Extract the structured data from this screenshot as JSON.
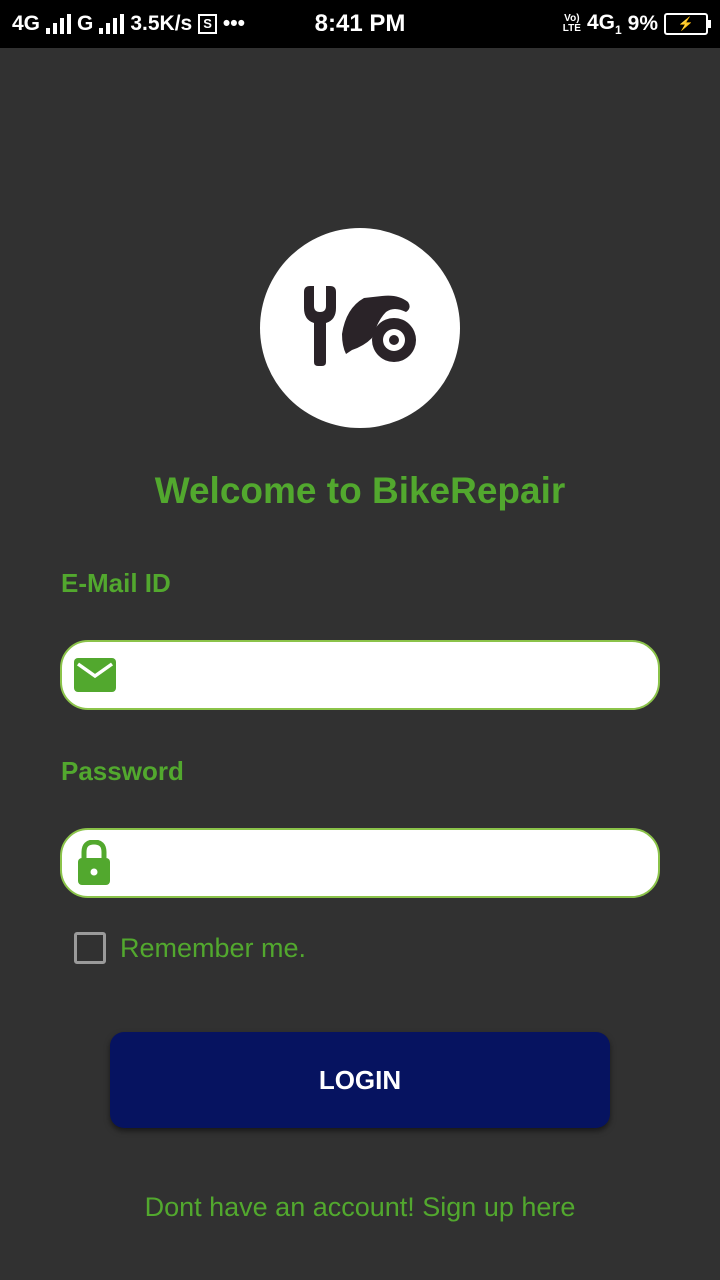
{
  "status_bar": {
    "net1": "4G",
    "net2": "G",
    "speed": "3.5K/s",
    "screen_icon_letter": "S",
    "more": "•••",
    "time": "8:41 PM",
    "volte_top": "Vo)",
    "volte_bottom": "LTE",
    "net3": "4G",
    "sim_index": "1",
    "battery_pct": "9%",
    "battery_icon": "⚡"
  },
  "logo": {
    "icon": "bike-repair-logo-icon"
  },
  "welcome": "Welcome to BikeRepair",
  "email": {
    "label": "E-Mail ID",
    "value": "",
    "placeholder": "",
    "icon": "mail-icon"
  },
  "password": {
    "label": "Password",
    "value": "",
    "placeholder": "",
    "icon": "lock-icon"
  },
  "remember": {
    "label": "Remember me.",
    "checked": false
  },
  "login_button": "LOGIN",
  "signup_link": "Dont have an account! Sign up here",
  "colors": {
    "background": "#313131",
    "accent_green": "#52a82e",
    "button": "#061360",
    "field_border": "#8bc34a"
  }
}
